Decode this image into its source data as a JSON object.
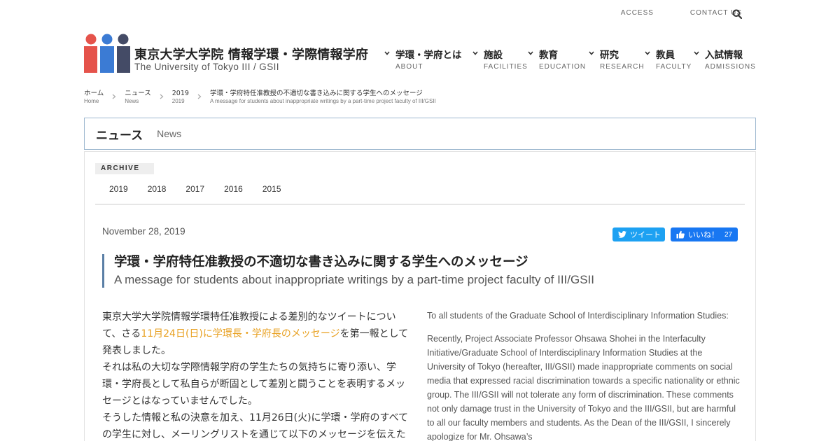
{
  "utility": {
    "access": "ACCESS",
    "contact": "CONTACT US"
  },
  "brand": {
    "name_ja": "東京大学大学院 情報学環・学際情報学府",
    "name_en": "The University of Tokyo III / GSII",
    "logo_colors": [
      "#e5534b",
      "#3b7bd4",
      "#444b66"
    ]
  },
  "nav": [
    {
      "ja": "学環・学府とは",
      "en": "ABOUT"
    },
    {
      "ja": "施設",
      "en": "FACILITIES"
    },
    {
      "ja": "教育",
      "en": "EDUCATION"
    },
    {
      "ja": "研究",
      "en": "RESEARCH"
    },
    {
      "ja": "教員",
      "en": "FACULTY"
    },
    {
      "ja": "入試情報",
      "en": "ADMISSIONS"
    }
  ],
  "breadcrumb": [
    {
      "ja": "ホーム",
      "en": "Home"
    },
    {
      "ja": "ニュース",
      "en": "News"
    },
    {
      "ja": "2019",
      "en": "2019"
    },
    {
      "ja": "学環・学府特任准教授の不適切な書き込みに関する学生へのメッセージ",
      "en": "A message for students about inappropriate writings by a part-time project faculty of III/GSII"
    }
  ],
  "section": {
    "title_ja": "ニュース",
    "title_en": "News"
  },
  "archive": {
    "label": "ARCHIVE",
    "years": [
      "2019",
      "2018",
      "2017",
      "2016",
      "2015"
    ]
  },
  "post": {
    "date": "November 28, 2019",
    "tweet_label": "ツイート",
    "like_label": "いいね！",
    "like_count": "27",
    "title_ja": "学環・学府特任准教授の不適切な書き込みに関する学生へのメッセージ",
    "title_en": "A message for students about inappropriate writings by a part-time project faculty of III/GSII",
    "body_ja": {
      "p1_before": "東京大学大学院情報学環特任准教授による差別的なツイートについて、さる",
      "p1_link": "11月24日(日)に学環長・学府長のメッセージ",
      "p1_after": "を第一報として発表しました。",
      "p2": "それは私の大切な学際情報学府の学生たちの気持ちに寄り添い、学環・学府長として私自らが断固として差別と闘うことを表明するメッセージとはなっていませんでした。",
      "p3": "そうした情報と私の決意を加え、11月26日(火)に学環・学府のすべての学生に対し、メーリングリストを通じて以下のメッセージを伝えた"
    },
    "body_en": {
      "p1": "To all students of the Graduate School of Interdisciplinary Information Studies:",
      "p2": "Recently, Project Associate Professor Ohsawa Shohei in the Interfaculty Initiative/Graduate School of Interdisciplinary Information Studies at the University of Tokyo (hereafter, III/GSII) made inappropriate comments on social media that expressed racial discrimination towards a specific nationality or ethnic group. The III/GSII will not tolerate any form of discrimination. These comments not only damage trust in the University of Tokyo and the III/GSII, but are harmful to all our faculty members and students. As the Dean of the III/GSII, I sincerely apologize for Mr. Ohsawa’s"
    }
  }
}
